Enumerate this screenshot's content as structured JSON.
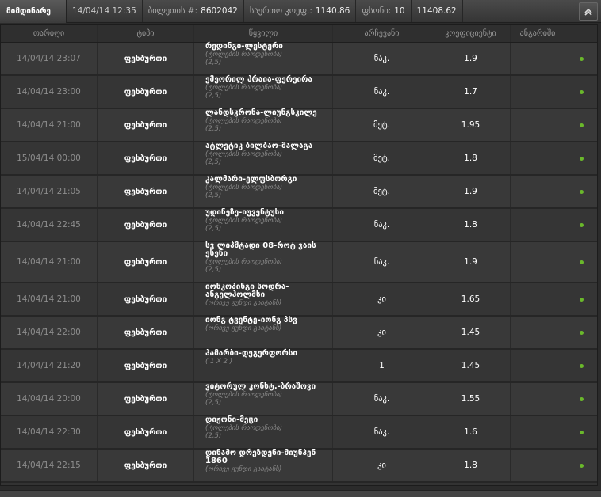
{
  "topbar": {
    "tab_label": "მიმდინარე",
    "datetime": "14/04/14 12:35",
    "ticket_label": "ბილეთის #:",
    "ticket_value": "8602042",
    "total_coef_label": "საერთო კოეფ.:",
    "total_coef_value": "1140.86",
    "stake_label": "ფსონი:",
    "stake_value": "10",
    "payout_value": "11408.62",
    "collapse_icon": "chevron-up-icon"
  },
  "table": {
    "headers": [
      "თარიღი",
      "ტიპი",
      "წყვილი",
      "არჩევანი",
      "კოეფიციენტი",
      "ანგარიში"
    ],
    "rows": [
      {
        "date": "14/04/14 23:07",
        "type": "ფეხბურთი",
        "event": "რედინგი-ლესტერი",
        "market": "(ტოლების რაოდენობა)",
        "line": "(2,5)",
        "choice": "ნაკ.",
        "coef": "1.9"
      },
      {
        "date": "14/04/14 23:00",
        "type": "ფეხბურთი",
        "event": "ემეორილ პრაია-ფერეირა",
        "market": "(ტოლების რაოდენობა)",
        "line": "(2,5)",
        "choice": "ნაკ.",
        "coef": "1.7"
      },
      {
        "date": "14/04/14 21:00",
        "type": "ფეხბურთი",
        "event": "ლანდსკრონა-ლიუნგსკილე",
        "market": "(ტოლების რაოდენობა)",
        "line": "(2,5)",
        "choice": "მეტ.",
        "coef": "1.95"
      },
      {
        "date": "15/04/14 00:00",
        "type": "ფეხბურთი",
        "event": "ატლეტიკ ბილბაო-მალაგა",
        "market": "(ტოლების რაოდენობა)",
        "line": "(2,5)",
        "choice": "მეტ.",
        "coef": "1.8"
      },
      {
        "date": "14/04/14 21:05",
        "type": "ფეხბურთი",
        "event": "კალმარი-ელფსბორგი",
        "market": "(ტოლების რაოდენობა)",
        "line": "(2,5)",
        "choice": "მეტ.",
        "coef": "1.9"
      },
      {
        "date": "14/04/14 22:45",
        "type": "ფეხბურთი",
        "event": "უდინეზე-იუვენტუსი",
        "market": "(ტოლების რაოდენობა)",
        "line": "(2,5)",
        "choice": "ნაკ.",
        "coef": "1.8"
      },
      {
        "date": "14/04/14 21:00",
        "type": "ფეხბურთი",
        "event": "სვ ლიპშტადი 08-როტ ვაის ესენი",
        "market": "(ტოლების რაოდენობა)",
        "line": "(2,5)",
        "choice": "ნაკ.",
        "coef": "1.9"
      },
      {
        "date": "14/04/14 21:00",
        "type": "ფეხბურთი",
        "event": "იონკოპინგი სოდრა-ანგელჰოლმსი",
        "market": "(ორივე გუნდი გაიტანს)",
        "line": "",
        "choice": "კი",
        "coef": "1.65"
      },
      {
        "date": "14/04/14 22:00",
        "type": "ფეხბურთი",
        "event": "იონგ ტვენტე-იონგ პსვ",
        "market": "(ორივე გუნდი გაიტანს)",
        "line": "",
        "choice": "კი",
        "coef": "1.45"
      },
      {
        "date": "14/04/14 21:20",
        "type": "ფეხბურთი",
        "event": "ჰამარბი-დეგერფორსი",
        "market": "( 1 X 2 )",
        "line": "",
        "choice": "1",
        "coef": "1.45"
      },
      {
        "date": "14/04/14 20:00",
        "type": "ფეხბურთი",
        "event": "ვიტორულ კონსტ.-ბრაშოვი",
        "market": "(ტოლების რაოდენობა)",
        "line": "(2,5)",
        "choice": "ნაკ.",
        "coef": "1.55"
      },
      {
        "date": "14/04/14 22:30",
        "type": "ფეხბურთი",
        "event": "დიჟონი-მეცი",
        "market": "(ტოლების რაოდენობა)",
        "line": "(2,5)",
        "choice": "ნაკ.",
        "coef": "1.6"
      },
      {
        "date": "14/04/14 22:15",
        "type": "ფეხბურთი",
        "event": "დინამო დრეზდენი-მიუნჰენ 1860",
        "market": "(ორივე გუნდი გაიტანს)",
        "line": "",
        "choice": "კი",
        "coef": "1.8"
      }
    ],
    "status_color": "#6ab82b"
  }
}
